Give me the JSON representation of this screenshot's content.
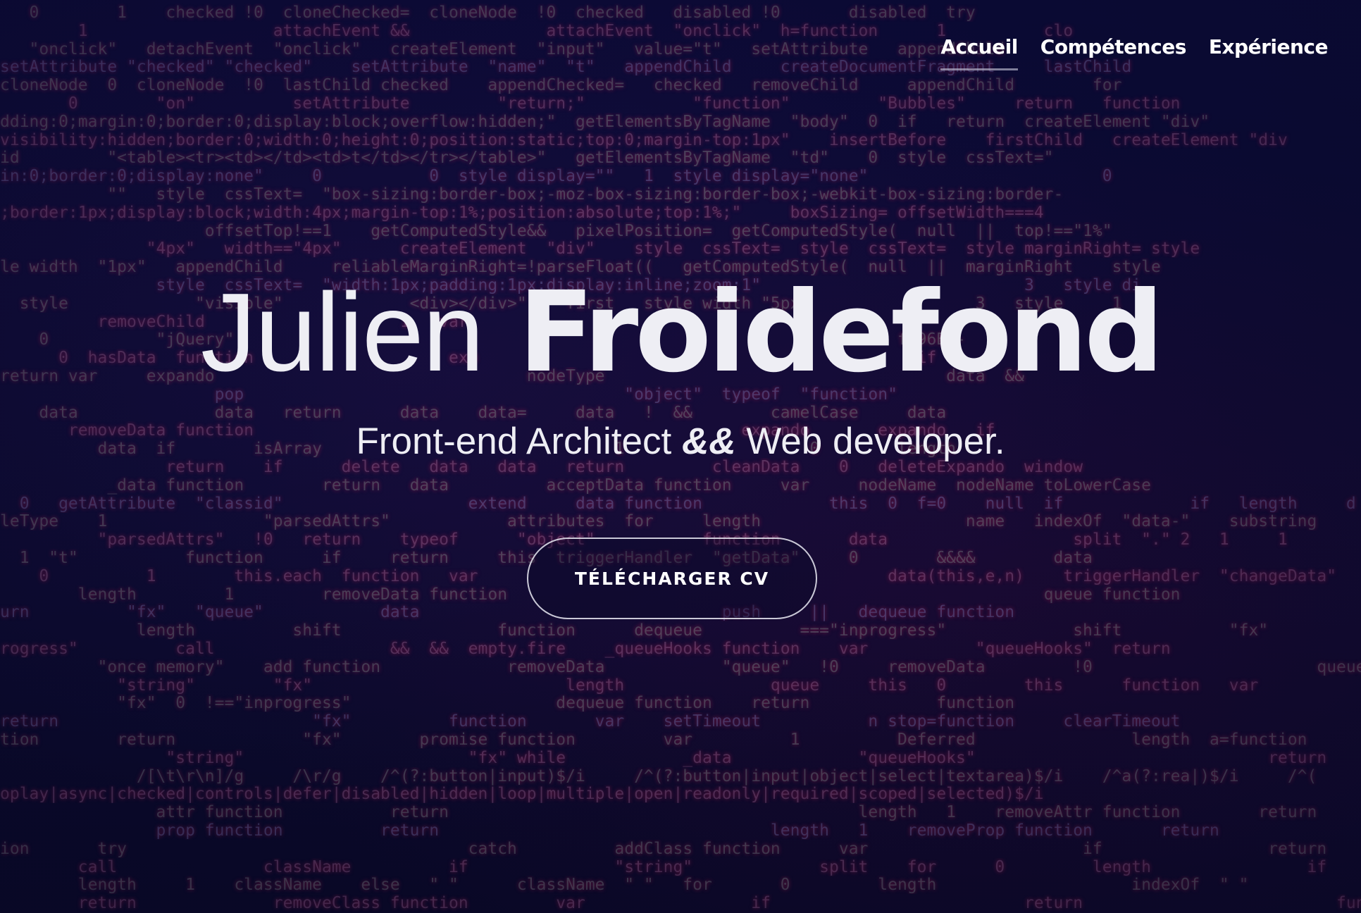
{
  "nav": {
    "items": [
      {
        "label": "Accueil",
        "active": true
      },
      {
        "label": "Compétences",
        "active": false
      },
      {
        "label": "Expérience",
        "active": false
      }
    ]
  },
  "hero": {
    "first_name": "Julien",
    "last_name": "Froidefond",
    "subtitle_part1": "Front-end Architect",
    "subtitle_amp": "&&",
    "subtitle_part2": "Web developer.",
    "cta_label": "TÉLÉCHARGER CV"
  },
  "background_code": [
    "   0        1    checked !0  cloneChecked=  cloneNode  !0  checked   disabled !0       disabled  try",
    "        1                   attachEvent &&              attachEvent  \"onclick\"  h=function      1          clo",
    "   \"onclick\"   detachEvent  \"onclick\"   createElement  \"input\"   value=\"t\"   setAttribute   appendChild  ",
    "setAttribute \"checked\" \"checked\"    setAttribute  \"name\"  \"t\"   appendChild     createDocumentFragment     lastChild",
    "cloneNode  0  cloneNode  !0  lastChild checked    appendChecked=   checked   removeChild     appendChild        for",
    "       0        \"on\"          setAttribute         \"return;\"           \"function\"         \"Bubbles\"     return   function",
    "dding:0;margin:0;border:0;display:block;overflow:hidden;\"  getElementsByTagName  \"body\"  0  if   return  createElement \"div\"",
    "visibility:hidden;border:0;width:0;height:0;position:static;top:0;margin-top:1px\"    insertBefore    firstChild   createElement \"div",
    "id         \"<table><tr><td></td><td>t</td></tr></table>\"   getElementsByTagName  \"td\"    0  style  cssText=\"",
    "in:0;border:0;display:none\"     0           0  style display=\"\"   1  style display=\"none\"                        0",
    "           \"\"   style  cssText=  \"box-sizing:border-box;-moz-box-sizing:border-box;-webkit-box-sizing:border-",
    ";border:1px;display:block;width:4px;margin-top:1%;position:absolute;top:1%;\"     boxSizing= offsetWidth===4",
    "                     offsetTop!==1    getComputedStyle&&   pixelPosition=  getComputedStyle(  null  ||  top!==\"1%\"",
    "               \"4px\"   width==\"4px\"      createElement  \"div\"    style  cssText=  style  cssText=  style marginRight= style",
    "le width  \"1px\"   appendChild     reliableMarginRight=!parseFloat((   getComputedStyle(  null  ||  marginRight    style",
    "                style  cssText=  \"width:1px;padding:1px;display:inline;zoom:1\"                           3   style di",
    "  style             \"visible\"             <div></div>\"    first   style width \"5px\"                 3   style     1",
    "          removeChild                    1   var                                                  ",
    "    0           \"jQuery\"                                                                    f-96B8-",
    "      0  hasData  function                    exp                                             if  ",
    "return var     expando                                nodeType                                   data  &&",
    "                      pop                                       \"object\"  typeof  \"function\"",
    "    data              data   return      data    data=     data   !  &&        camelCase     data",
    "       removeData function                                                  expando       expando   if",
    "          data  if        isArray                              1                   0        length",
    "                 return    if      delete   data   data   return         cleanData    0   deleteExpando  window",
    "           _data function        return   data          acceptData function     var     nodeName  nodeName toLowerCase",
    "  0   getAttribute  \"classid\"                   extend     data function             this  0  f=0    null  if             if   length     d",
    "leType    1                \"parsedAttrs\"            attributes  for     length                     name   indexOf  \"data-\"    substring",
    "          \"parsedAttrs\"   !0   return    typeof      \"object\"           function       data                   split  \".\" 2   1     1",
    "  1  \"t\"           function      if     return     this  triggerHandler  \"getData\"     0        &&&&        data",
    "    0          1        this.each  function   var                                          data(this,e,n)    triggerHandler  \"changeData\"",
    "        length         1         removeData function                                                       queue function",
    "urn          \"fx\"   \"queue\"            data                               push     ||   dequeue function",
    "              length          shift                function      dequeue          ===\"inprogress\"             shift           \"fx\"",
    "rogress\"          call                  &&  &&  empty.fire    _queueHooks function    var           \"queueHooks\"  return",
    "          \"once memory\"    add function             removeData            \"queue\"   !0     removeData         !0                       queue function",
    "            \"string\"        \"fx\"                          length               queue     this   0        this      function   var",
    "            \"fx\"  0  !==\"inprogress\"                     dequeue function    return             function",
    "return                          \"fx\"          function       var    setTimeout           n stop=function     clearTimeout",
    "tion        return             \"fx\"        promise function         var          1          Deferred                length  a=function",
    "                 \"string\"                       \"fx\" while            _data             \"queueHooks\"                              return",
    "              /[\\t\\r\\n]/g     /\\r/g    /^(?:button|input)$/i     /^(?:button|input|object|select|textarea)$/i    /^a(?:rea|)$/i     /^(",
    "oplay|async|checked|controls|defer|disabled|hidden|loop|multiple|open|readonly|required|scoped|selected)$/i",
    "                attr function           return                                          length   1    removeAttr function        return          function",
    "                prop function          return                                  length   1    removeProp function       return",
    "ion       try                                   catch          addClass function      var                      if                 return         function",
    "        call               className          if               \"string\"             split    for      0         length                if     nodeType    1",
    "        length     1    className    else   \" \"      className  \" \"   for       0         length                    indexOf  \" \"                        cl",
    "        return              removeClass function         var                 if                          return                          function"
  ]
}
